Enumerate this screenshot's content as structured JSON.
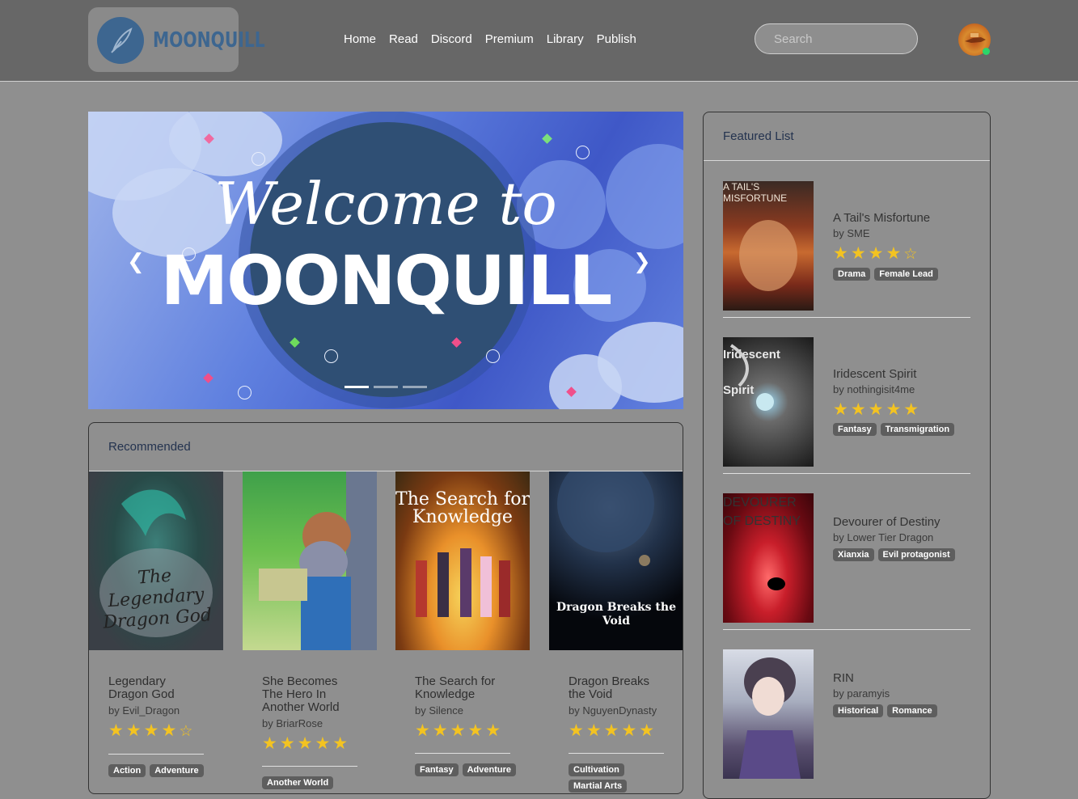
{
  "brand": {
    "logo_text": "MOONQUILL",
    "accent": "#3d6690"
  },
  "nav": {
    "items": [
      "Home",
      "Read",
      "Discord",
      "Premium",
      "Library",
      "Publish"
    ]
  },
  "search": {
    "placeholder": "Search",
    "value": ""
  },
  "hero": {
    "line1": "Welcome to",
    "line2": "MOONQUILL",
    "prev_icon": "chevron-left-icon",
    "next_icon": "chevron-right-icon",
    "slides": 3,
    "active_slide": 1
  },
  "recommended": {
    "heading": "Recommended",
    "books": [
      {
        "title": "Legendary Dragon God",
        "author": "by Evil_Dragon",
        "rating": 4,
        "tags": [
          "Action",
          "Adventure"
        ],
        "cover_text": "The Legendary Dragon God"
      },
      {
        "title": "She Becomes The Hero In Another World",
        "author": "by BriarRose",
        "rating": 5,
        "tags": [
          "Another World"
        ],
        "cover_text": ""
      },
      {
        "title": "The Search for Knowledge",
        "author": "by Silence",
        "rating": 5,
        "tags": [
          "Fantasy",
          "Adventure"
        ],
        "cover_text": "The Search for Knowledge"
      },
      {
        "title": "Dragon Breaks the Void",
        "author": "by NguyenDynasty",
        "rating": 5,
        "tags": [
          "Cultivation",
          "Martial Arts"
        ],
        "cover_text": "Dragon Breaks the Void"
      }
    ]
  },
  "featured": {
    "heading": "Featured List",
    "books": [
      {
        "title": "A Tail's Misfortune",
        "author": "by SME",
        "rating": 4,
        "tags": [
          "Drama",
          "Female Lead"
        ],
        "cover_text": "A TAIL'S MISFORTUNE"
      },
      {
        "title": "Iridescent Spirit",
        "author": "by nothingisit4me",
        "rating": 5,
        "tags": [
          "Fantasy",
          "Transmigration"
        ],
        "cover_text": "Iridescent Spirit"
      },
      {
        "title": "Devourer of Destiny",
        "author": "by Lower Tier Dragon",
        "rating": null,
        "tags": [
          "Xianxia",
          "Evil protagonist"
        ],
        "cover_text": "DEVOURER OF DESTINY"
      },
      {
        "title": "RIN",
        "author": "by paramyis",
        "rating": null,
        "tags": [
          "Historical",
          "Romance"
        ],
        "cover_text": ""
      }
    ]
  },
  "colors": {
    "star": "#f3c321",
    "tag_bg": "#5e5e5e",
    "header_bg": "#676767",
    "page_bg": "#8f8f8f"
  }
}
